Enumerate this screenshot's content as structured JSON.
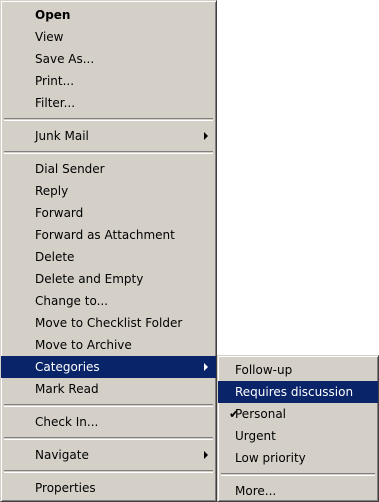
{
  "main_menu": {
    "open": "Open",
    "view": "View",
    "save_as": "Save As...",
    "print": "Print...",
    "filter": "Filter...",
    "junk_mail": "Junk Mail",
    "dial_sender": "Dial Sender",
    "reply": "Reply",
    "forward": "Forward",
    "forward_as_attachment": "Forward as Attachment",
    "delete": "Delete",
    "delete_and_empty": "Delete and Empty",
    "change_to": "Change to...",
    "move_to_checklist": "Move to Checklist Folder",
    "move_to_archive": "Move to Archive",
    "categories": "Categories",
    "mark_read": "Mark Read",
    "check_in": "Check In...",
    "navigate": "Navigate",
    "properties": "Properties"
  },
  "categories_menu": {
    "follow_up": "Follow-up",
    "requires_discussion": "Requires discussion",
    "personal": "Personal",
    "urgent": "Urgent",
    "low_priority": "Low priority",
    "more": "More...",
    "check_glyph": "✔"
  },
  "colors": {
    "menu_bg": "#d4d0c8",
    "highlight_bg": "#0a246a",
    "highlight_text": "#ffffff"
  }
}
